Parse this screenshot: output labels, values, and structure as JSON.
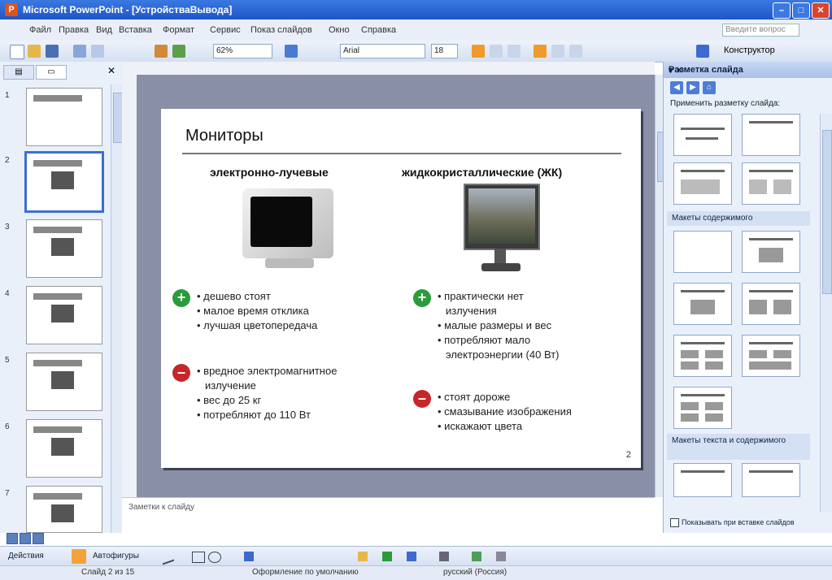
{
  "window": {
    "title": "Microsoft PowerPoint - [УстройстваВывода]"
  },
  "menu": [
    "Файл",
    "Правка",
    "Вид",
    "Вставка",
    "Формат",
    "Сервис",
    "Показ слайдов",
    "Окно",
    "Справка"
  ],
  "help_box": "Введите вопрос",
  "toolbar": {
    "zoom": "62%",
    "font": "Arial",
    "size": "18",
    "design": "Конструктор"
  },
  "slides_pane": {
    "tabs": [
      "Структура",
      "Слайды"
    ],
    "numbers": [
      "1",
      "2",
      "3",
      "4",
      "5",
      "6",
      "7"
    ]
  },
  "slide": {
    "title": "Мониторы",
    "left_head": "электронно-лучевые",
    "right_head": "жидкокристаллические (ЖК)",
    "left_pros": [
      "дешево стоят",
      "малое время отклика",
      "лучшая цветопередача"
    ],
    "left_cons": [
      "вредное электромагнитное",
      "излучение",
      "вес до 25 кг",
      "потребляют до 110 Вт"
    ],
    "right_pros": [
      "практически нет",
      "излучения",
      "малые размеры и вес",
      "потребляют мало",
      "электроэнергии (40 Вт)"
    ],
    "right_cons": [
      "стоят дороже",
      "смазывание изображения",
      "искажают цвета"
    ],
    "page_number": "2"
  },
  "notes": {
    "placeholder": "Заметки к слайду"
  },
  "taskpane": {
    "title": "Разметка слайда",
    "apply_label": "Применить разметку слайда:",
    "section_content": "Макеты содержимого",
    "section_text_content": "Макеты текста и содержимого",
    "show_on_insert": "Показывать при вставке слайдов"
  },
  "drawing": {
    "actions": "Действия",
    "autoshapes": "Автофигуры"
  },
  "status": {
    "slide": "Слайд 2 из 15",
    "design": "Оформление по умолчанию",
    "lang": "русский (Россия)"
  },
  "colors": {
    "plus": "#2b9b3b",
    "minus": "#c6262a",
    "title_bar": "#2a63d4"
  }
}
